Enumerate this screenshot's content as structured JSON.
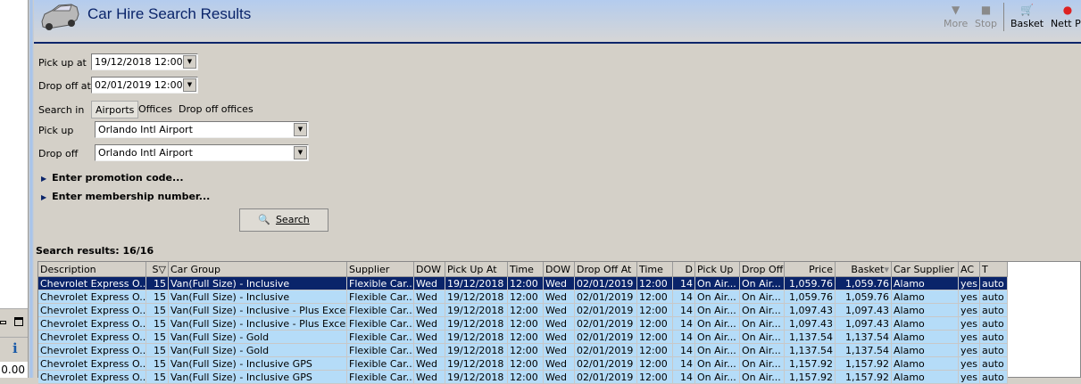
{
  "window": {
    "title": "Car Hire Search Results"
  },
  "toolbar": [
    {
      "label": "More",
      "icon": "triangle-down-icon",
      "enabled": false
    },
    {
      "label": "Stop",
      "icon": "stop-icon",
      "enabled": false
    },
    {
      "label": "Basket",
      "icon": "basket-icon",
      "enabled": true
    },
    {
      "label": "Nett Pr",
      "icon": "fruit-icon",
      "enabled": true
    }
  ],
  "left_pane": {
    "value": "0.00"
  },
  "form": {
    "pickup_at_label": "Pick up at",
    "pickup_at": "19/12/2018 12:00",
    "dropoff_at_label": "Drop off at",
    "dropoff_at": "02/01/2019 12:00",
    "search_in_label": "Search in",
    "search_in_tabs": [
      "Airports",
      "Offices",
      "Drop off offices"
    ],
    "pickup_label": "Pick up",
    "pickup": "Orlando Intl Airport",
    "dropoff_label": "Drop off",
    "dropoff": "Orlando Intl Airport",
    "promo": "Enter promotion code...",
    "membership": "Enter membership number...",
    "search_button": "Search"
  },
  "results": {
    "summary": "Search results: 16/16",
    "columns": [
      "Description",
      "S",
      "Car Group",
      "Supplier",
      "DOW",
      "Pick Up At",
      "Time",
      "DOW",
      "Drop Off At",
      "Time",
      "D",
      "Pick Up",
      "Drop Off",
      "Price",
      "Basket",
      "Car Supplier",
      "AC",
      "T"
    ],
    "rows": [
      [
        "Chevrolet Express O...",
        "15",
        "Van(Full Size) - Inclusive",
        "Flexible Car...",
        "Wed",
        "19/12/2018",
        "12:00",
        "Wed",
        "02/01/2019",
        "12:00",
        "14",
        "On Air...",
        "On Air...",
        "1,059.76",
        "1,059.76",
        "Alamo",
        "yes",
        "auto"
      ],
      [
        "Chevrolet Express O...",
        "15",
        "Van(Full Size) - Inclusive",
        "Flexible Car...",
        "Wed",
        "19/12/2018",
        "12:00",
        "Wed",
        "02/01/2019",
        "12:00",
        "14",
        "On Air...",
        "On Air...",
        "1,059.76",
        "1,059.76",
        "Alamo",
        "yes",
        "auto"
      ],
      [
        "Chevrolet Express O...",
        "15",
        "Van(Full Size) - Inclusive - Plus Excess...",
        "Flexible Car...",
        "Wed",
        "19/12/2018",
        "12:00",
        "Wed",
        "02/01/2019",
        "12:00",
        "14",
        "On Air...",
        "On Air...",
        "1,097.43",
        "1,097.43",
        "Alamo",
        "yes",
        "auto"
      ],
      [
        "Chevrolet Express O...",
        "15",
        "Van(Full Size) - Inclusive - Plus Excess...",
        "Flexible Car...",
        "Wed",
        "19/12/2018",
        "12:00",
        "Wed",
        "02/01/2019",
        "12:00",
        "14",
        "On Air...",
        "On Air...",
        "1,097.43",
        "1,097.43",
        "Alamo",
        "yes",
        "auto"
      ],
      [
        "Chevrolet Express O...",
        "15",
        "Van(Full Size) - Gold",
        "Flexible Car...",
        "Wed",
        "19/12/2018",
        "12:00",
        "Wed",
        "02/01/2019",
        "12:00",
        "14",
        "On Air...",
        "On Air...",
        "1,137.54",
        "1,137.54",
        "Alamo",
        "yes",
        "auto"
      ],
      [
        "Chevrolet Express O...",
        "15",
        "Van(Full Size) - Gold",
        "Flexible Car...",
        "Wed",
        "19/12/2018",
        "12:00",
        "Wed",
        "02/01/2019",
        "12:00",
        "14",
        "On Air...",
        "On Air...",
        "1,137.54",
        "1,137.54",
        "Alamo",
        "yes",
        "auto"
      ],
      [
        "Chevrolet Express O...",
        "15",
        "Van(Full Size) - Inclusive GPS",
        "Flexible Car...",
        "Wed",
        "19/12/2018",
        "12:00",
        "Wed",
        "02/01/2019",
        "12:00",
        "14",
        "On Air...",
        "On Air...",
        "1,157.92",
        "1,157.92",
        "Alamo",
        "yes",
        "auto"
      ],
      [
        "Chevrolet Express O...",
        "15",
        "Van(Full Size) - Inclusive GPS",
        "Flexible Car...",
        "Wed",
        "19/12/2018",
        "12:00",
        "Wed",
        "02/01/2019",
        "12:00",
        "14",
        "On Air...",
        "On Air...",
        "1,157.92",
        "1,157.92",
        "Alamo",
        "yes",
        "auto"
      ]
    ],
    "selected_row": 0
  },
  "colors": {
    "accent": "#0a246a",
    "row_bg": "#b5dcf8",
    "selected_bg": "#0a246a"
  }
}
